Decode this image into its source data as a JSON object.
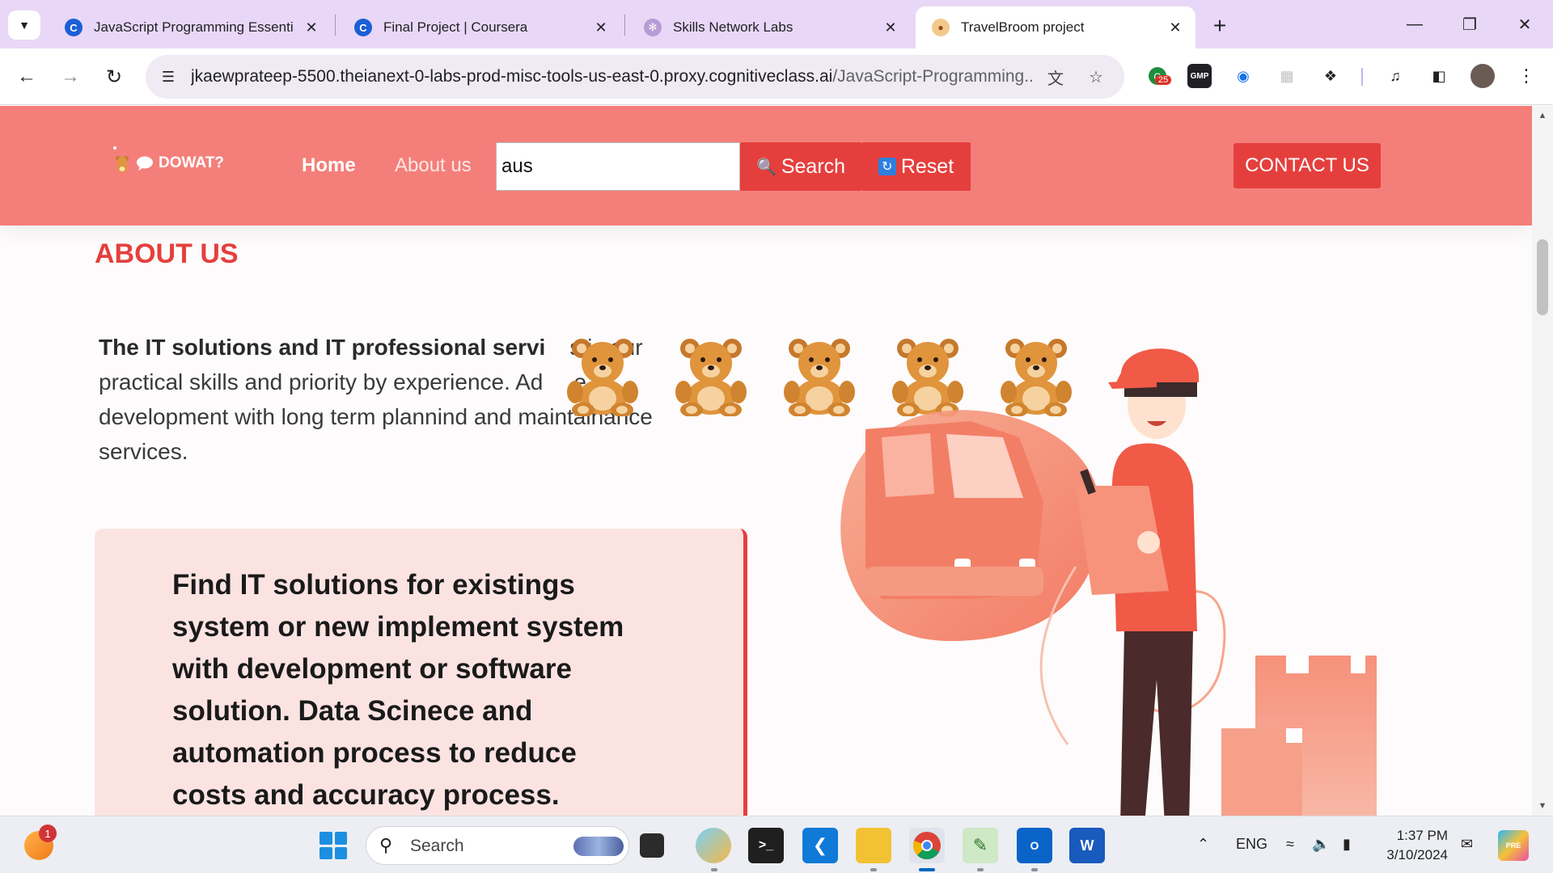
{
  "browser": {
    "tabs": [
      {
        "title": "JavaScript Programming Essenti",
        "favicon": "coursera-icon",
        "active": false
      },
      {
        "title": "Final Project | Coursera",
        "favicon": "coursera-icon",
        "active": false
      },
      {
        "title": "Skills Network Labs",
        "favicon": "skills-network-icon",
        "active": false
      },
      {
        "title": "TravelBroom project",
        "favicon": "teddy-bear-icon",
        "active": true
      }
    ],
    "url_host": "jkaewprateep-5500.theianext-0-labs-prod-misc-tools-us-east-0.proxy.cognitiveclass.ai",
    "url_path": "/JavaScript-Programming...",
    "extension_badge": "25",
    "gmp_label": "GMP"
  },
  "site": {
    "logo_text": "DOWAT?",
    "nav": {
      "home": "Home",
      "about": "About us"
    },
    "search": {
      "value": "aus",
      "button": "Search",
      "reset": "Reset"
    },
    "contact": "CONTACT US",
    "about_title": "ABOUT US",
    "intro_bold": "The IT solutions and IT professional servi",
    "intro_rest_line1": "s is our",
    "intro_line2": "practical skills and priority by experience. Ad",
    "intro_line2_tail": "e",
    "intro_line3": "development with long term plannind and maintainance",
    "intro_line4": "services.",
    "card_text": "Find IT solutions for existings system or new implement system with development or software solution. Data Scinece and automation process to reduce costs and accuracy process.",
    "bear_count": 5
  },
  "taskbar": {
    "search_placeholder": "Search",
    "weather_badge": "1",
    "language": "ENG",
    "time": "1:37 PM",
    "date": "3/10/2024"
  },
  "colors": {
    "header": "#f47f7a",
    "accent": "#e53f3d",
    "card_bg": "#fbe3e2",
    "tabbar": "#e9d7f7"
  }
}
